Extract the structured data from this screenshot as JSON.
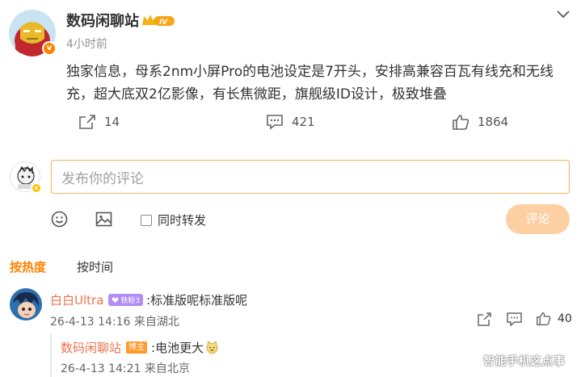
{
  "post": {
    "author": "数码闲聊站",
    "vip_level": "IV",
    "time": "4小时前",
    "text": "独家信息，母系2nm小屏Pro的电池设定是7开头，安排高兼容百瓦有线充和无线充，超大底双2亿影像，有长焦微距，旗舰级ID设计，极致堆叠",
    "reposts": "14",
    "comments": "421",
    "likes": "1864"
  },
  "composer": {
    "placeholder": "发布你的评论",
    "repost_label": "同时转发",
    "submit_label": "评论"
  },
  "sort_tabs": {
    "hot": "按热度",
    "time": "按时间"
  },
  "comments": [
    {
      "user": "白白Ultra",
      "fan_badge": "铁粉3",
      "text": ":标准版呢标准版呢",
      "meta": "26-4-13 14:16 来自湖北",
      "likes": "40",
      "reply": {
        "user": "数码闲聊站",
        "badge": "博主",
        "text": ":电池更大",
        "meta": "26-4-13 14:21 来自北京"
      }
    }
  ],
  "watermark": "智能手机这点事",
  "colors": {
    "accent": "#ff8200",
    "username": "#eb7350",
    "composer_border": "#f5b35a",
    "submit_disabled": "#fdd0a3",
    "fan_badge": "#b28cf5",
    "host_badge": "#ff9a2e"
  }
}
